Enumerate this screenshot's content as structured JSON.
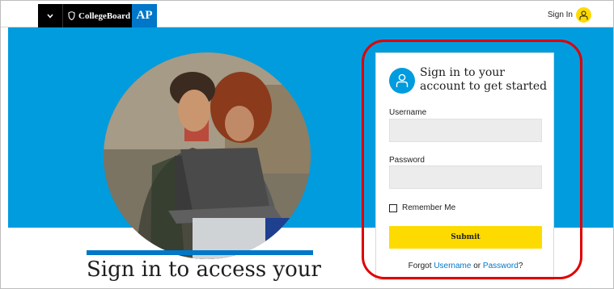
{
  "header": {
    "menu_icon": "chevron-down-icon",
    "collegeboard_logo_text": "CollegeBoard",
    "ap_logo_text": "AP",
    "signin_label": "Sign In",
    "avatar_icon": "user-icon",
    "colors": {
      "brand_black": "#000000",
      "ap_blue": "#0077c8",
      "accent_yellow": "#fedb00"
    }
  },
  "hero": {
    "band_color": "#009cde",
    "photo": "students-with-laptop-photo"
  },
  "content": {
    "heading": "Sign in to access your"
  },
  "signin_card": {
    "icon": "user-icon",
    "title_line1": "Sign in to your",
    "title_line2": "account to get started",
    "username_label": "Username",
    "username_value": "",
    "password_label": "Password",
    "password_value": "",
    "remember_label": "Remember Me",
    "remember_checked": false,
    "submit_label": "Submit",
    "forgot_prefix": "Forgot ",
    "forgot_username": "Username",
    "forgot_or": " or ",
    "forgot_password": "Password",
    "forgot_suffix": "?"
  }
}
